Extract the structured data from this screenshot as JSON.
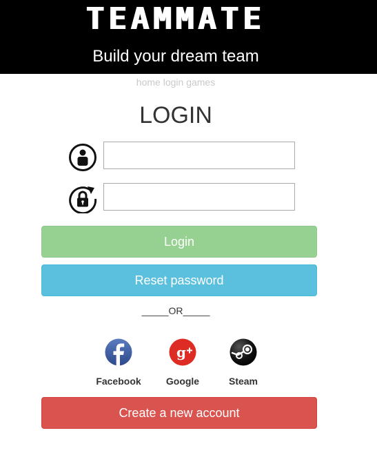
{
  "header": {
    "brand": "TEAMMATE",
    "tagline": "Build your dream team"
  },
  "nav": {
    "items": [
      "home",
      "login",
      "games"
    ]
  },
  "form": {
    "title": "LOGIN",
    "username": {
      "value": "",
      "icon": "user-icon"
    },
    "password": {
      "value": "",
      "icon": "lock-reset-icon"
    }
  },
  "buttons": {
    "login": "Login",
    "reset": "Reset password",
    "create": "Create a new account"
  },
  "separator": "_____OR_____",
  "social": [
    {
      "label": "Facebook",
      "icon": "facebook-icon",
      "color": "#3b5998"
    },
    {
      "label": "Google",
      "icon": "google-plus-icon",
      "color": "#dd2c23"
    },
    {
      "label": "Steam",
      "icon": "steam-icon",
      "color": "#000000"
    }
  ],
  "colors": {
    "header_bg": "#000000",
    "login": "#96d191",
    "reset": "#5bc0de",
    "create": "#d9534f"
  }
}
